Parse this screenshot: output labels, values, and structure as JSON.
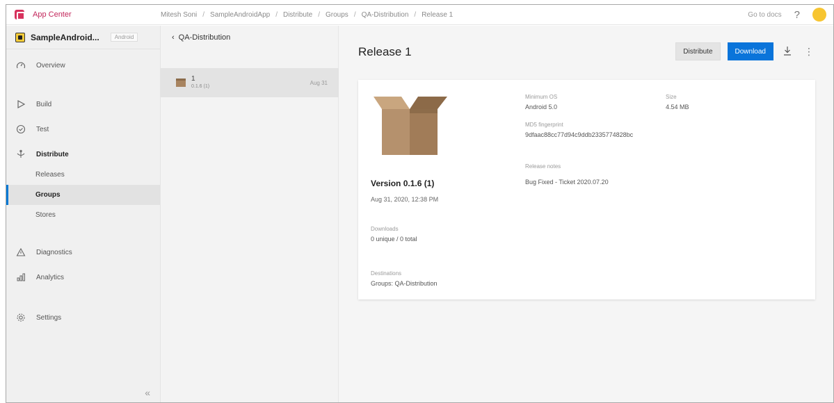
{
  "topbar": {
    "app_name": "App Center",
    "breadcrumbs": [
      "Mitesh Soni",
      "SampleAndroidApp",
      "Distribute",
      "Groups",
      "QA-Distribution",
      "Release 1"
    ],
    "separator": "/",
    "docs_link": "Go to docs",
    "help_label": "?"
  },
  "sidebar": {
    "app_name": "SampleAndroid...",
    "platform": "Android",
    "items": [
      {
        "label": "Overview",
        "icon": "overview-icon"
      },
      {
        "label": "Build",
        "icon": "play-icon"
      },
      {
        "label": "Test",
        "icon": "check-circle-icon"
      },
      {
        "label": "Distribute",
        "icon": "distribute-icon"
      },
      {
        "label": "Diagnostics",
        "icon": "warning-icon"
      },
      {
        "label": "Analytics",
        "icon": "bar-chart-icon"
      },
      {
        "label": "Settings",
        "icon": "gear-icon"
      }
    ],
    "distribute_sub": [
      "Releases",
      "Groups",
      "Stores"
    ],
    "active_sub": "Groups"
  },
  "group_panel": {
    "back_label": "QA-Distribution",
    "release": {
      "version": "1",
      "build": "0.1.6 (1)",
      "date": "Aug 31"
    }
  },
  "main": {
    "title": "Release 1",
    "distribute_button": "Distribute",
    "download_button": "Download",
    "details": {
      "version": "Version 0.1.6 (1)",
      "date": "Aug 31, 2020, 12:38 PM",
      "downloads_label": "Downloads",
      "downloads_value": "0 unique / 0 total",
      "destinations_label": "Destinations",
      "destinations_value": "Groups: QA-Distribution",
      "min_os_label": "Minimum OS",
      "min_os_value": "Android 5.0",
      "size_label": "Size",
      "size_value": "4.54 MB",
      "md5_label": "MD5 fingerprint",
      "md5_value": "9dfaac88cc77d94c9ddb2335774828bc",
      "notes_label": "Release notes",
      "notes_value": "Bug Fixed - Ticket 2020.07.20"
    }
  },
  "colors": {
    "brand": "#c2255a",
    "accent": "#0a74da",
    "avatar": "#f7c531"
  }
}
